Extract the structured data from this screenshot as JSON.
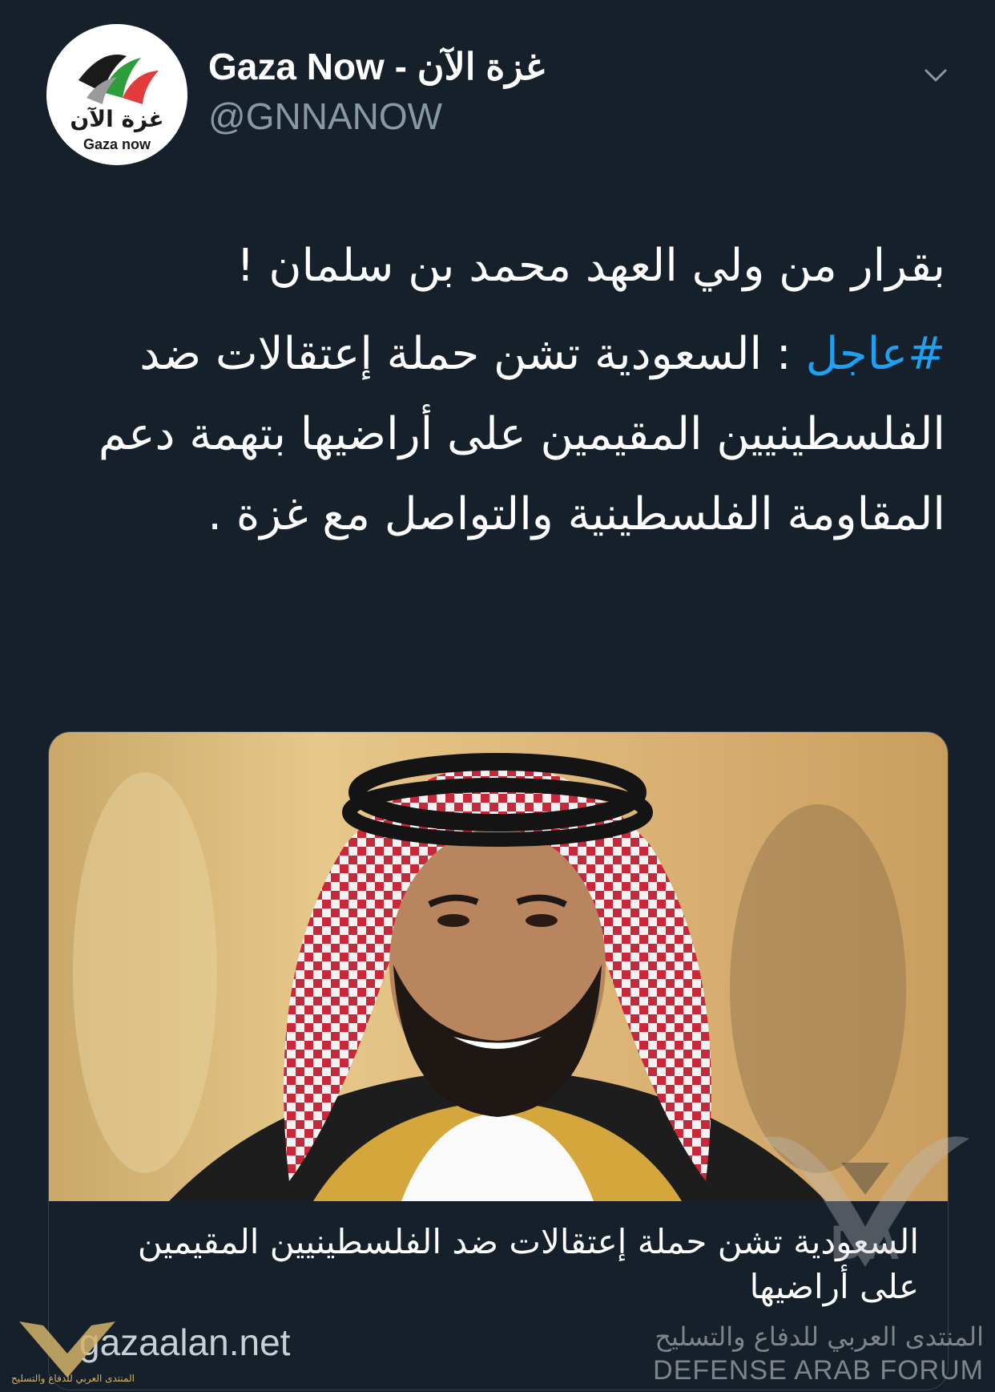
{
  "author": {
    "display_name": "Gaza Now - غزة الآن",
    "handle": "@GNNANOW",
    "avatar": {
      "icon": "gaza-now-logo",
      "logo_text_ar": "غزة الآن",
      "logo_text_en": "Gaza now"
    }
  },
  "menu": {
    "icon": "chevron-down-icon"
  },
  "tweet": {
    "line1": "بقرار من ولي العهد محمد بن سلمان !",
    "hashtag": "#عاجل",
    "body": " : السعودية تشن حملة إعتقالات ضد الفلسطينيين المقيمين على أراضيها بتهمة دعم المقاومة الفلسطينية والتواصل مع غزة ."
  },
  "card": {
    "title": "السعودية تشن حملة إعتقالات ضد الفلسطينيين المقيمين على أراضيها",
    "domain": "gazaalan.net"
  },
  "watermark": {
    "arabic": "المنتدى العربي للدفاع والتسليح",
    "english": "DEFENSE ARAB FORUM",
    "small_arabic": "المنتدى العربي للدفاع والتسليح"
  },
  "colors": {
    "background": "#15202b",
    "hashtag": "#1da1f2",
    "secondary_text": "#8899a6"
  }
}
